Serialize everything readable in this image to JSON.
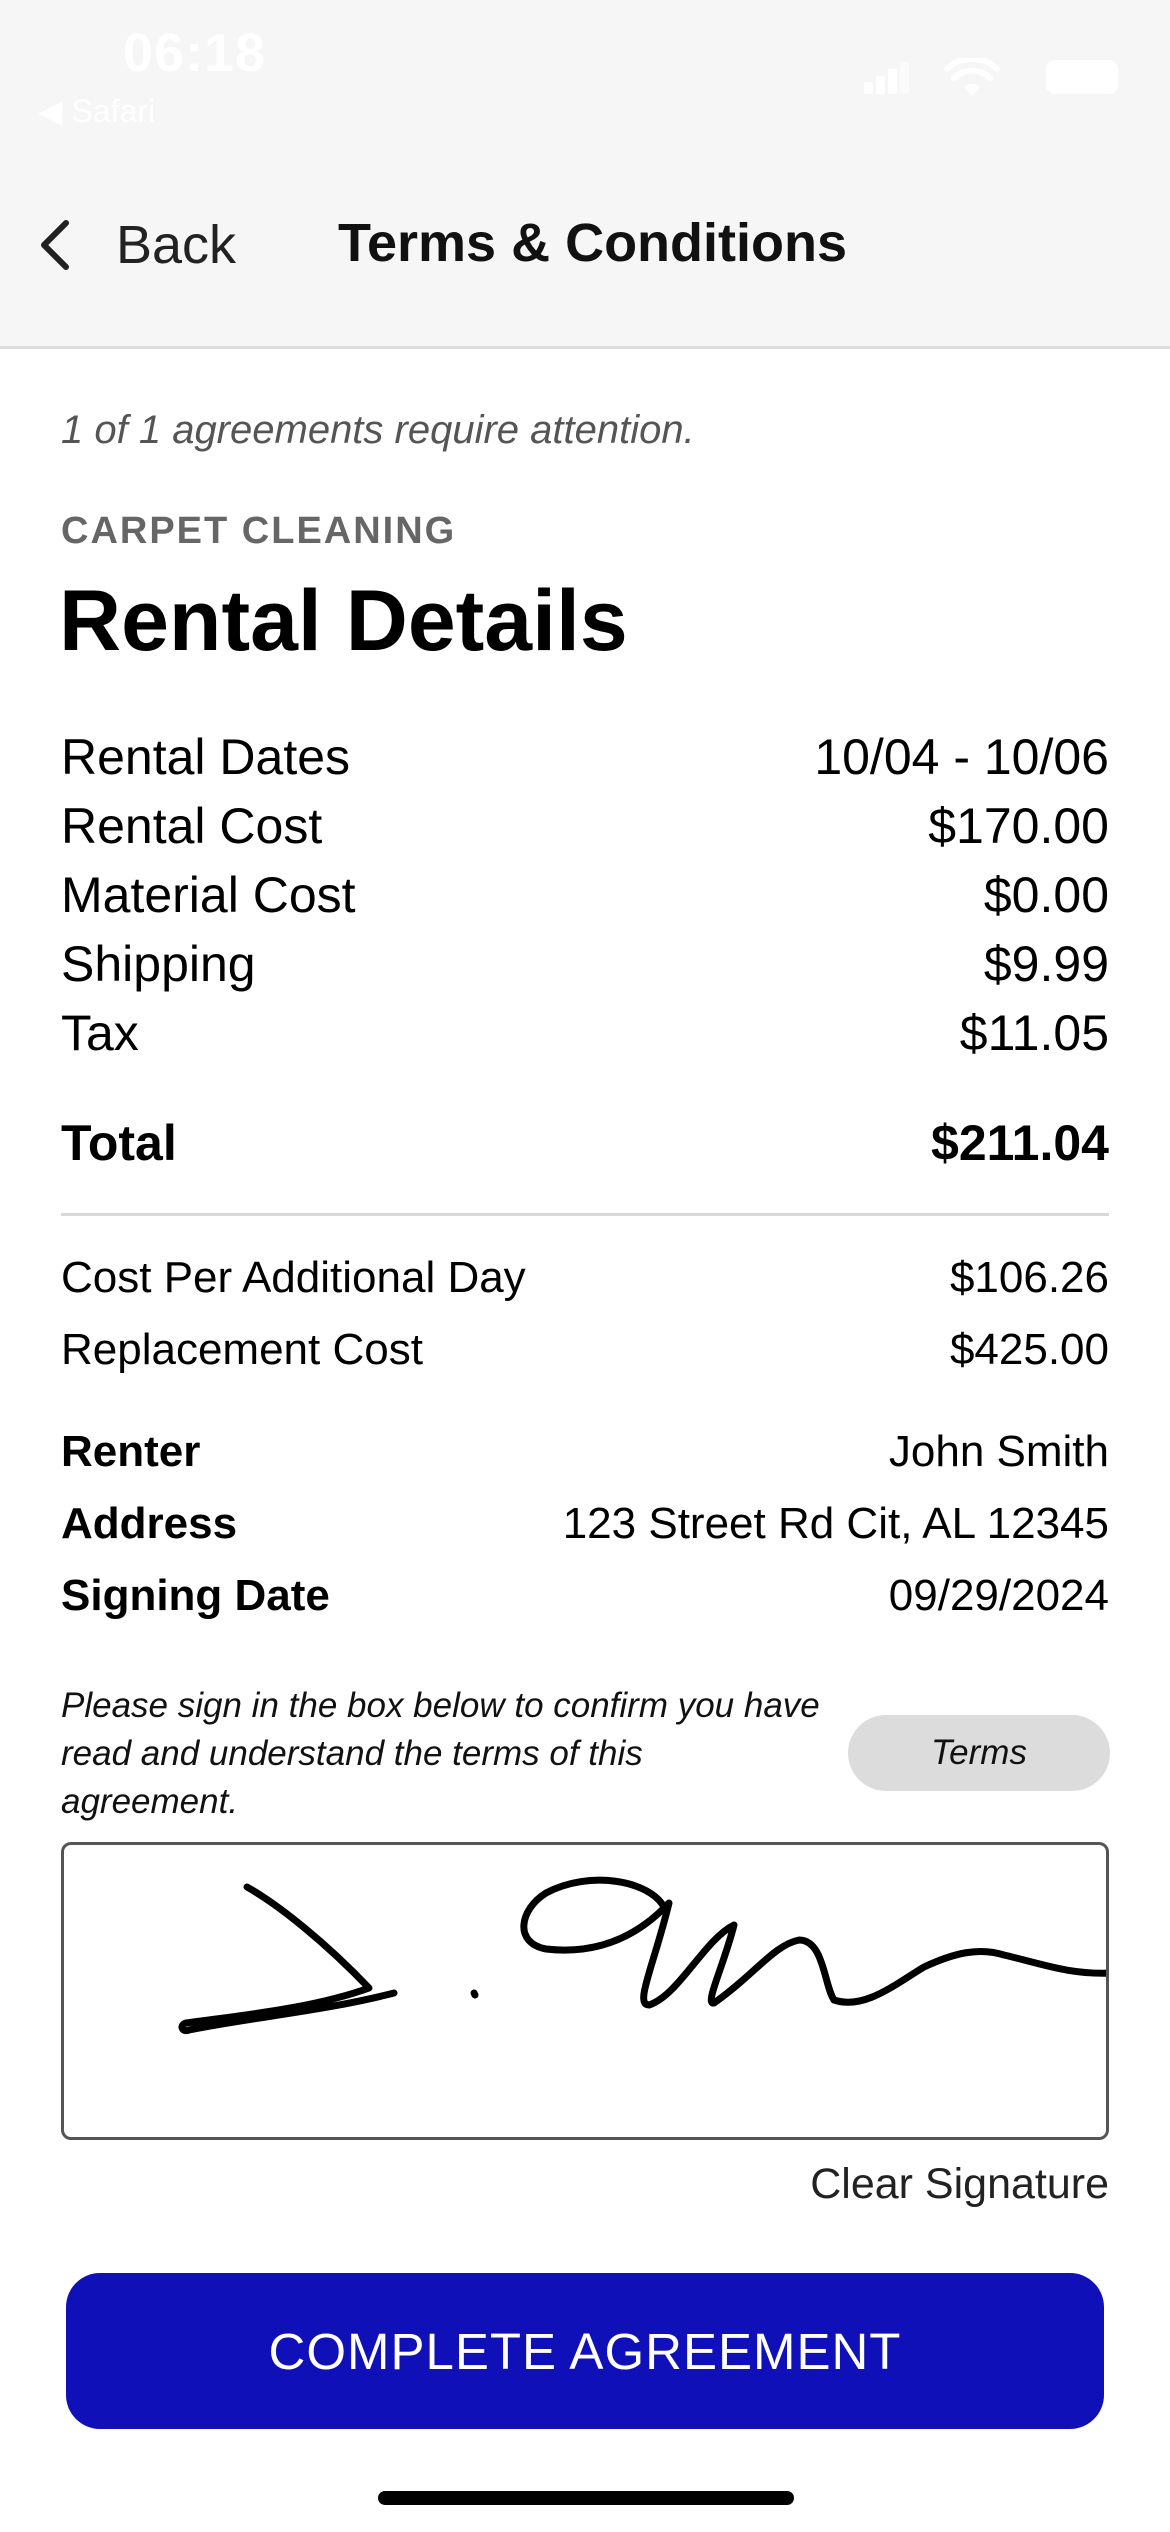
{
  "status_bar": {
    "time": "06:18",
    "back_app": "◀ Safari"
  },
  "nav": {
    "back_label": "Back",
    "title": "Terms & Conditions"
  },
  "attention_text": "1 of 1 agreements require attention.",
  "category": "CARPET CLEANING",
  "section_title": "Rental Details",
  "costs": [
    {
      "label": "Rental Dates",
      "value": "10/04 - 10/06"
    },
    {
      "label": "Rental Cost",
      "value": "$170.00"
    },
    {
      "label": "Material Cost",
      "value": "$0.00"
    },
    {
      "label": "Shipping",
      "value": "$9.99"
    },
    {
      "label": "Tax",
      "value": "$11.05"
    }
  ],
  "total": {
    "label": "Total",
    "value": "$211.04"
  },
  "extra_costs": [
    {
      "label": "Cost Per Additional Day",
      "value": "$106.26"
    },
    {
      "label": "Replacement Cost",
      "value": "$425.00"
    }
  ],
  "renter_info": [
    {
      "label": "Renter",
      "value": "John Smith"
    },
    {
      "label": "Address",
      "value": "123 Street Rd Cit, AL 12345"
    },
    {
      "label": "Signing Date",
      "value": "09/29/2024"
    }
  ],
  "instructions": "Please sign in the box below to confirm you have read and understand the terms of this agreement.",
  "terms_button": "Terms",
  "clear_signature": "Clear Signature",
  "complete_button": "COMPLETE AGREEMENT",
  "colors": {
    "primary_button": "#1010b8",
    "header_bg": "#f6f6f6"
  }
}
